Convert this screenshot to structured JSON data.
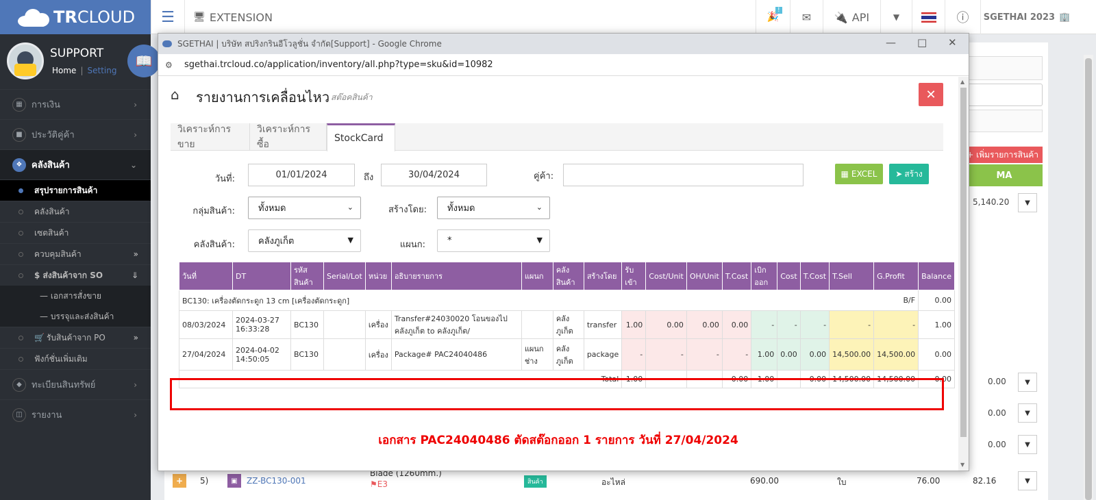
{
  "topbar": {
    "brand_bold": "TR",
    "brand_light": "CLOUD",
    "extension_label": "EXTENSION",
    "notification_count": "!",
    "api_label": "API",
    "company": "SGETHAI 2023"
  },
  "sidebar": {
    "profile_name": "SUPPORT",
    "home_link": "Home",
    "setting_link": "Setting",
    "sep": "|",
    "items": [
      {
        "label": "การเงิน"
      },
      {
        "label": "ประวัติคู่ค้า"
      },
      {
        "label": "คลังสินค้า"
      }
    ],
    "sub_items": [
      {
        "label": "สรุปรายการสินค้า"
      },
      {
        "label": "คลังสินค้า"
      },
      {
        "label": "เซตสินค้า"
      },
      {
        "label": "ควบคุมสินค้า"
      },
      {
        "label": "$ ส่งสินค้าจาก SO"
      }
    ],
    "so_children": [
      {
        "label": "— เอกสารสั่งขาย"
      },
      {
        "label": "— บรรจุและส่งสินค้า"
      }
    ],
    "sub_items2": [
      {
        "label": "รับสินค้าจาก PO"
      },
      {
        "label": "ฟังก์ชั่นเพิ่มเติม"
      }
    ],
    "items2": [
      {
        "label": "ทะเบียนสินทรัพย์"
      },
      {
        "label": "รายงาน"
      }
    ]
  },
  "background": {
    "add_item_button": "+ เพิ่มรายการสินค้า",
    "ma_label": "MA",
    "value_1": "5,140.20",
    "value_zero": "0.00",
    "row5_plus": "+",
    "row5_num": "5)",
    "row5_code": "ZZ-BC130-001",
    "row5_desc": "Blade (1260mm.)",
    "row5_tag": "E3",
    "row5_type": "สินค้า",
    "row5_group": "อะไหล่",
    "row5_price": "690.00",
    "row5_unit": "ใบ",
    "row5_v1": "76.00",
    "row5_v2": "82.16"
  },
  "popup": {
    "window_title": "SGETHAI | บริษัท สปริงกรินอีโวลูชั่น จำกัด[Support] - Google Chrome",
    "url": "sgethai.trcloud.co/application/inventory/all.php?type=sku&id=10982",
    "title": "รายงานการเคลื่อนไหว",
    "subtitle": "สต๊อคสินค้า",
    "tabs": [
      "วิเคราะห์การขาย",
      "วิเคราะห์การซื้อ",
      "StockCard"
    ],
    "form": {
      "date_label": "วันที่:",
      "date_from": "01/01/2024",
      "to_label": "ถึง",
      "date_to": "30/04/2024",
      "partner_label": "คู่ค้า:",
      "partner_value": "",
      "group_label": "กลุ่มสินค้า:",
      "group_value": "ทั้งหมด",
      "created_by_label": "สร้างโดย:",
      "created_by_value": "ทั้งหมด",
      "warehouse_label": "คลังสินค้า:",
      "warehouse_value": "คลังภูเก็ต",
      "dept_label": "แผนก:",
      "dept_value": "*",
      "excel_button": "EXCEL",
      "create_button": "สร้าง"
    },
    "table": {
      "headers": [
        "วันที่",
        "DT",
        "รหัส สินค้า",
        "Serial/Lot",
        "หน่วย",
        "อธิบายรายการ",
        "แผนก",
        "คลัง สินค้า",
        "สร้างโดย",
        "รับ เข้า",
        "Cost/Unit",
        "OH/Unit",
        "T.Cost",
        "เบิก ออก",
        "Cost",
        "T.Cost",
        "T.Sell",
        "G.Profit",
        "Balance"
      ],
      "group_label": "BC130: เครื่องตัดกระดูก 13 cm [เครื่องตัดกระดูก]",
      "bf_label": "B/F",
      "bf_value": "0.00",
      "rows": [
        {
          "date": "08/03/2024",
          "dt": "2024-03-27 16:33:28",
          "code": "BC130",
          "serial": "",
          "unit": "เครื่อง",
          "desc": "Transfer#24030020 โอนของไปคลังภูเก็ต to คลังภูเก็ต/",
          "dept": "",
          "wh": "คลัง ภูเก็ต",
          "by": "transfer",
          "in": "1.00",
          "cost_unit": "0.00",
          "oh_unit": "0.00",
          "tcost_in": "0.00",
          "out": "-",
          "cost": "-",
          "tcost": "-",
          "tsell": "-",
          "gprofit": "-",
          "balance": "1.00"
        },
        {
          "date": "27/04/2024",
          "dt": "2024-04-02 14:50:05",
          "code": "BC130",
          "serial": "",
          "unit": "เครื่อง",
          "desc": "Package# PAC24040486",
          "dept": "แผนก ช่าง",
          "wh": "คลัง ภูเก็ต",
          "by": "package",
          "in": "-",
          "cost_unit": "-",
          "oh_unit": "-",
          "tcost_in": "-",
          "out": "1.00",
          "cost": "0.00",
          "tcost": "0.00",
          "tsell": "14,500.00",
          "gprofit": "14,500.00",
          "balance": "0.00"
        }
      ],
      "total": {
        "label": "Total",
        "in": "1.00",
        "tcost_in": "0.00",
        "out": "1.00",
        "tcost": "0.00",
        "tsell": "14,500.00",
        "gprofit": "14,500.00",
        "balance": "0.00"
      }
    },
    "note": "เอกสาร PAC24040486 ตัดสต๊อกออก 1 รายการ วันที่ 27/04/2024"
  },
  "colors": {
    "brand": "#4f77b8",
    "table_header": "#8e5ea2",
    "highlight": "#ee0000",
    "excel": "#8bc34a",
    "create": "#26b99a",
    "close": "#e9595c"
  }
}
